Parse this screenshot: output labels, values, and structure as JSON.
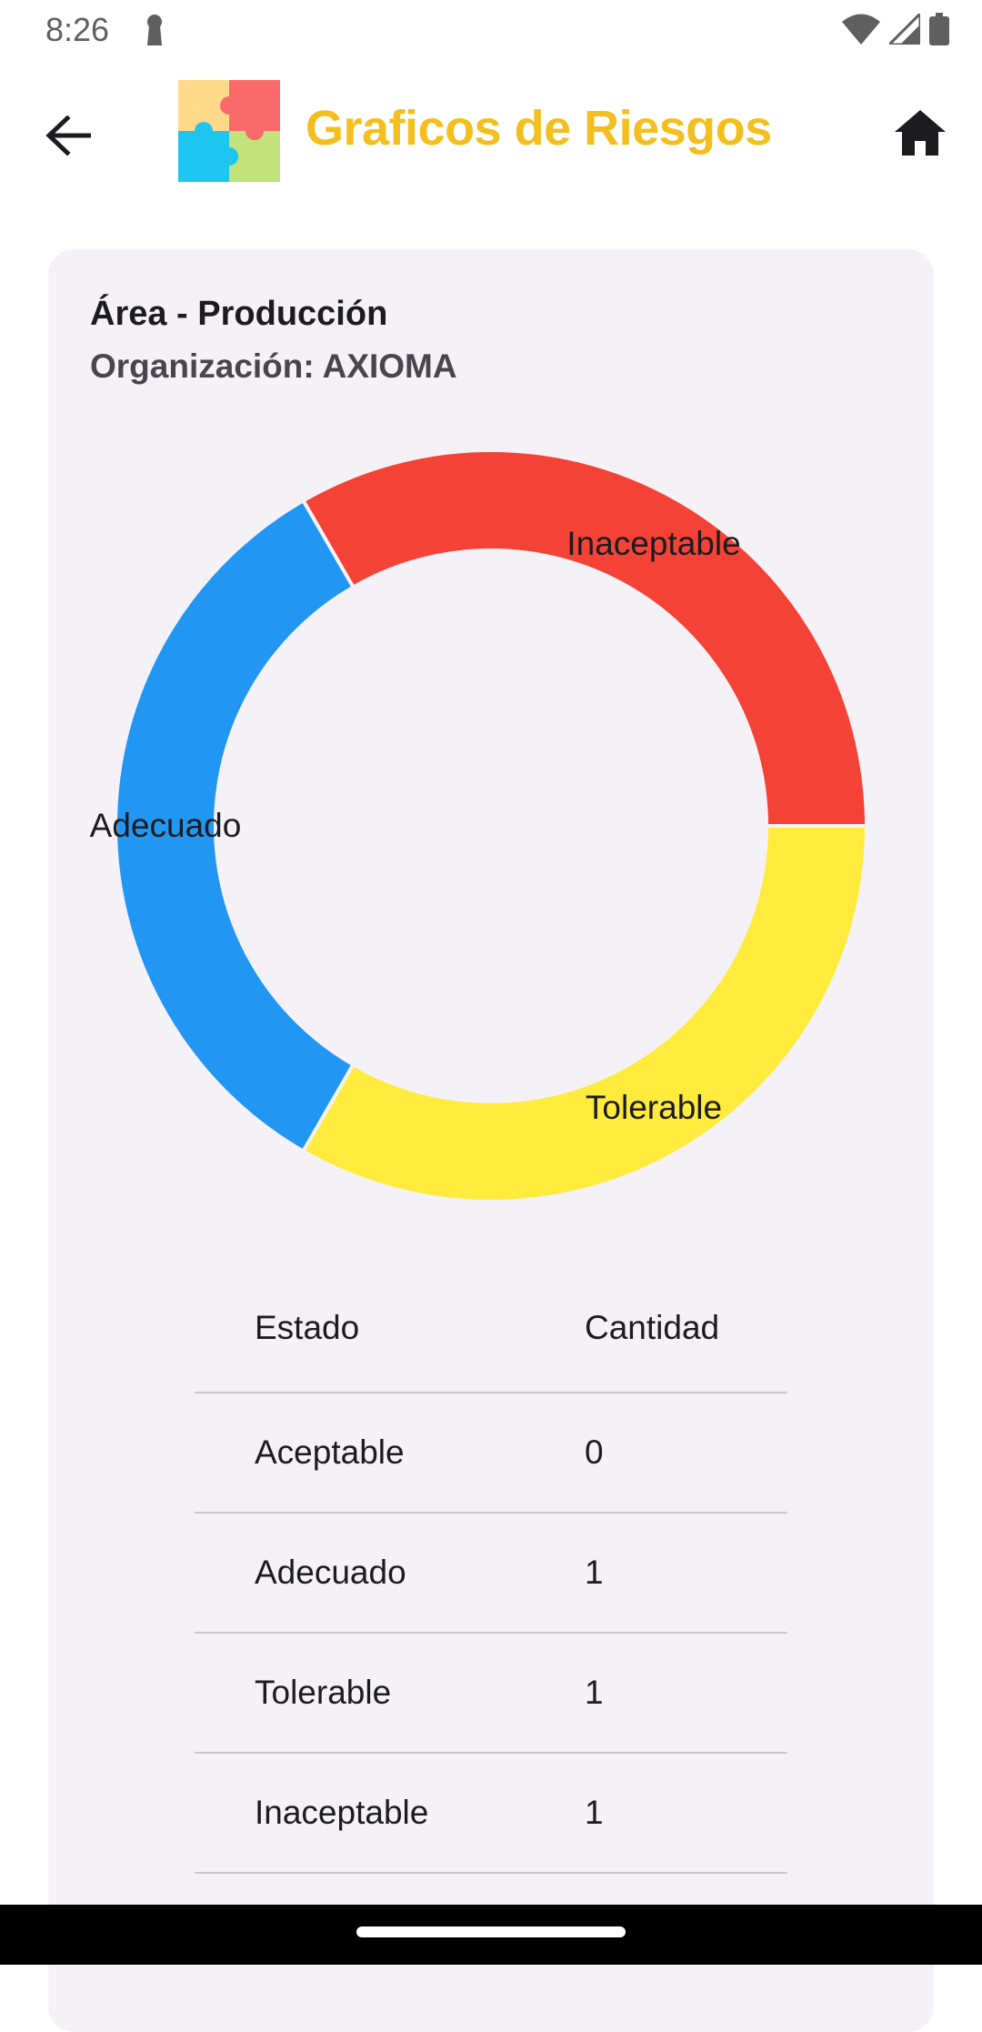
{
  "status_bar": {
    "time": "8:26",
    "icons": [
      "notification-icon",
      "wifi-icon",
      "signal-icon",
      "battery-icon"
    ]
  },
  "app_bar": {
    "title": "Graficos de Riesgos",
    "title_color": "#f3bf1e",
    "back_icon": "arrow-back-icon",
    "logo_icon": "puzzle-logo-icon",
    "home_icon": "home-icon"
  },
  "card": {
    "title": "Área - Producción",
    "subtitle": "Organización: AXIOMA"
  },
  "chart_data": {
    "type": "pie",
    "donut": true,
    "categories": [
      "Inaceptable",
      "Adecuado",
      "Tolerable",
      "Aceptable"
    ],
    "values": [
      1,
      1,
      1,
      0
    ],
    "colors": [
      "#f44336",
      "#2196f3",
      "#ffeb3b",
      "#4caf50"
    ],
    "labels": [
      "Inaceptable",
      "Adecuado",
      "Tolerable",
      ""
    ]
  },
  "table": {
    "headers": [
      "Estado",
      "Cantidad"
    ],
    "rows": [
      {
        "estado": "Aceptable",
        "cantidad": "0"
      },
      {
        "estado": "Adecuado",
        "cantidad": "1"
      },
      {
        "estado": "Tolerable",
        "cantidad": "1"
      },
      {
        "estado": "Inaceptable",
        "cantidad": "1"
      }
    ]
  }
}
